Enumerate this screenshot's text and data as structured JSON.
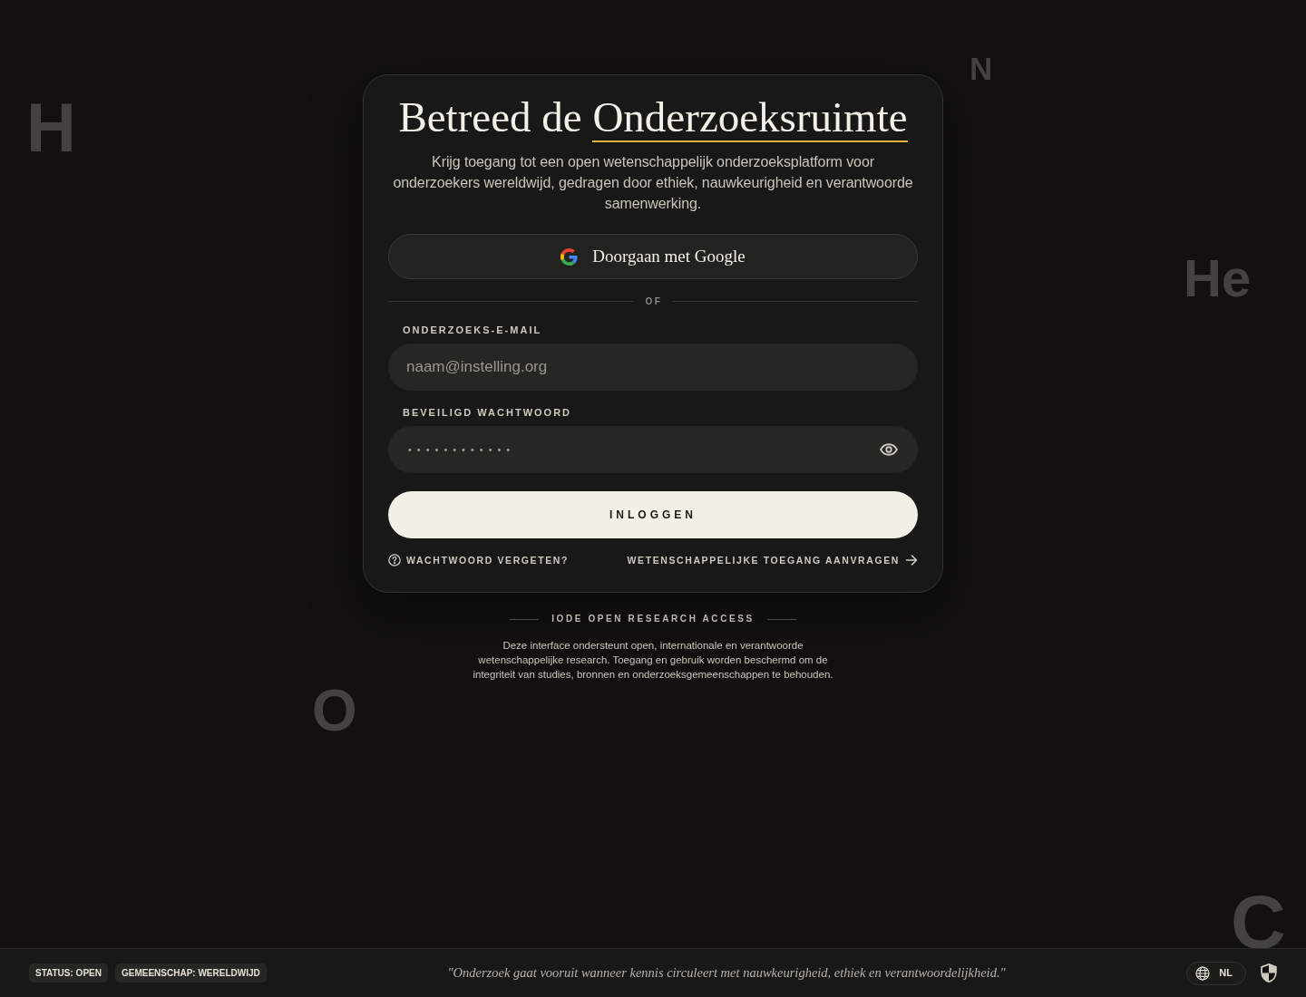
{
  "background_symbols": [
    {
      "symbol": "H"
    },
    {
      "symbol": "N"
    },
    {
      "symbol": "He"
    },
    {
      "symbol": "O"
    },
    {
      "symbol": "C"
    }
  ],
  "login_card": {
    "title": {
      "text": "Betreed de",
      "underlined": "Onderzoeksruimte"
    },
    "subtitle": "Krijg toegang tot een open wetenschappelijk onderzoeksplatform voor onderzoekers wereldwijd, gedragen door ethiek, nauwkeurigheid en verantwoorde samenwerking.",
    "google_button": {
      "label": "Doorgaan met Google"
    },
    "divider": "OF",
    "fields": [
      {
        "kind": "email",
        "label": "ONDERZOEKS-E-MAIL",
        "placeholder": "naam@instelling.org"
      },
      {
        "kind": "password",
        "label": "BEVEILIGD WACHTWOORD",
        "value": "••••••••••••"
      }
    ],
    "submit_button": "INLOGGEN",
    "links": [
      {
        "kind": "help",
        "label": "WACHTWOORD VERGETEN?"
      },
      {
        "kind": "forward",
        "label": "WETENSCHAPPELIJKE TOEGANG AANVRAGEN"
      }
    ]
  },
  "notice": {
    "heading": "IODE OPEN RESEARCH ACCESS",
    "text": "Deze interface ondersteunt open, internationale en verantwoorde wetenschappelijke research. Toegang en gebruik worden beschermd om de integriteit van studies, bronnen en onderzoeksgemeenschappen te behouden."
  },
  "footer": {
    "badges": [
      "STATUS: OPEN",
      "GEMEENSCHAP: WERELDWIJD"
    ],
    "quote": "\"Onderzoek gaat vooruit wanneer kennis circuleert met nauwkeurigheid, ethiek en verantwoordelijkheid.\"",
    "language": "NL"
  }
}
